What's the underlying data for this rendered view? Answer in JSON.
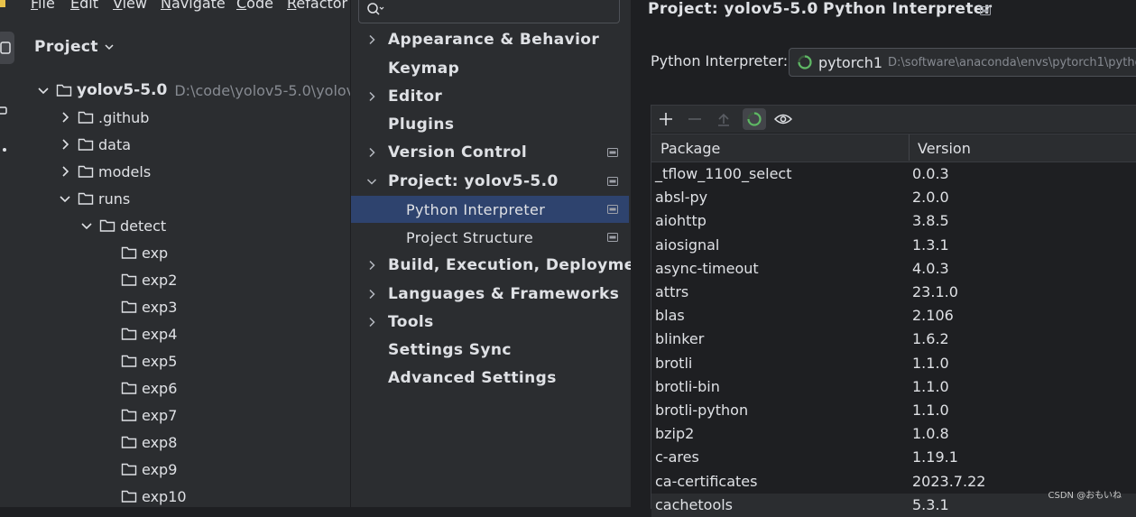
{
  "menubar": {
    "items": [
      "File",
      "Edit",
      "View",
      "Navigate",
      "Code",
      "Refactor"
    ]
  },
  "project_panel": {
    "title": "Project",
    "root": {
      "name": "yolov5-5.0",
      "path": "D:\\code\\yolov5-5.0\\yolov"
    },
    "tree": [
      {
        "label": ".github",
        "level": 1,
        "expanded": false
      },
      {
        "label": "data",
        "level": 1,
        "expanded": false
      },
      {
        "label": "models",
        "level": 1,
        "expanded": false
      },
      {
        "label": "runs",
        "level": 1,
        "expanded": true
      },
      {
        "label": "detect",
        "level": 2,
        "expanded": true
      },
      {
        "label": "exp",
        "level": 3
      },
      {
        "label": "exp2",
        "level": 3
      },
      {
        "label": "exp3",
        "level": 3
      },
      {
        "label": "exp4",
        "level": 3
      },
      {
        "label": "exp5",
        "level": 3
      },
      {
        "label": "exp6",
        "level": 3
      },
      {
        "label": "exp7",
        "level": 3
      },
      {
        "label": "exp8",
        "level": 3
      },
      {
        "label": "exp9",
        "level": 3
      },
      {
        "label": "exp10",
        "level": 3
      }
    ]
  },
  "settings": {
    "search": {
      "placeholder": ""
    },
    "nav": [
      {
        "label": "Appearance & Behavior",
        "chevron": "right"
      },
      {
        "label": "Keymap"
      },
      {
        "label": "Editor",
        "chevron": "right"
      },
      {
        "label": "Plugins"
      },
      {
        "label": "Version Control",
        "chevron": "right",
        "project_icon": true
      },
      {
        "label": "Project: yolov5-5.0",
        "chevron": "down",
        "project_icon": true
      },
      {
        "label": "Python Interpreter",
        "sub": true,
        "selected": true,
        "project_icon": true
      },
      {
        "label": "Project Structure",
        "sub": true,
        "project_icon": true
      },
      {
        "label": "Build, Execution, Deployment",
        "chevron": "right"
      },
      {
        "label": "Languages & Frameworks",
        "chevron": "right"
      },
      {
        "label": "Tools",
        "chevron": "right"
      },
      {
        "label": "Settings Sync"
      },
      {
        "label": "Advanced Settings"
      }
    ],
    "breadcrumb": {
      "parent": "Project: yolov5-5.0",
      "separator": "›",
      "current": "Python Interpreter"
    },
    "interpreter": {
      "label": "Python Interpreter:",
      "name": "pytorch1",
      "path": "D:\\software\\anaconda\\envs\\pytorch1\\pytho"
    },
    "packages": {
      "columns": [
        "Package",
        "Version"
      ],
      "rows": [
        [
          "_tflow_1100_select",
          "0.0.3"
        ],
        [
          "absl-py",
          "2.0.0"
        ],
        [
          "aiohttp",
          "3.8.5"
        ],
        [
          "aiosignal",
          "1.3.1"
        ],
        [
          "async-timeout",
          "4.0.3"
        ],
        [
          "attrs",
          "23.1.0"
        ],
        [
          "blas",
          "2.106"
        ],
        [
          "blinker",
          "1.6.2"
        ],
        [
          "brotli",
          "1.1.0"
        ],
        [
          "brotli-bin",
          "1.1.0"
        ],
        [
          "brotli-python",
          "1.1.0"
        ],
        [
          "bzip2",
          "1.0.8"
        ],
        [
          "c-ares",
          "1.19.1"
        ],
        [
          "ca-certificates",
          "2023.7.22"
        ],
        [
          "cachetools",
          "5.3.1"
        ]
      ]
    }
  },
  "watermark": "CSDN @おもいね",
  "colors": {
    "panel_bg": "#2b2d30",
    "content_bg": "#1e1f22",
    "selection": "#2e436e",
    "text": "#dfe1e5",
    "muted_text": "#868a91",
    "spinner_green": "#5fb865"
  }
}
